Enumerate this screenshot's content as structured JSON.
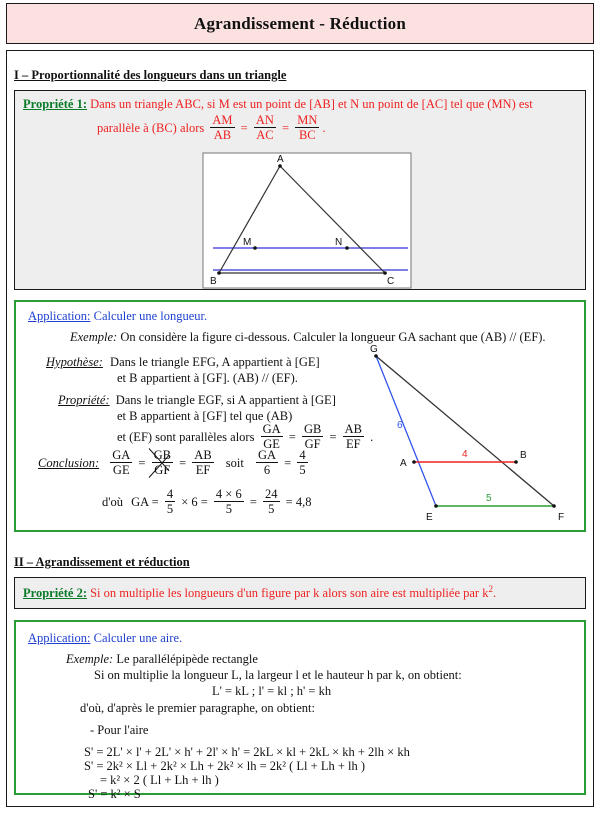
{
  "document": {
    "title": "Agrandissement - Réduction"
  },
  "section1": {
    "heading": "I – Proportionnalité des longueurs dans un triangle",
    "property": {
      "label": "Propriété 1:",
      "line1": "Dans un triangle ABC, si M est un point de [AB] et N un point de [AC] tel que (MN) est",
      "line2": "parallèle à (BC) alors",
      "fractions": [
        {
          "num": "AM",
          "den": "AB"
        },
        {
          "num": "AN",
          "den": "AC"
        },
        {
          "num": "MN",
          "den": "BC"
        }
      ],
      "period": "."
    },
    "figure": {
      "name": "triangle-abc",
      "vertices": {
        "A": "A",
        "B": "B",
        "C": "C",
        "M": "M",
        "N": "N"
      },
      "line_color": "#5555dd",
      "stroke_color": "#333333"
    },
    "application": {
      "label": "Application:",
      "title": "Calculer une longueur.",
      "example_label": "Exemple:",
      "example_text": "On considère la figure ci-dessous. Calculer la longueur GA sachant que (AB) // (EF).",
      "hypothese_label": "Hypothèse:",
      "hypothese_l1": "Dans le triangle EFG, A appartient à [GE]",
      "hypothese_l2": "et B appartient à [GF]. (AB) // (EF).",
      "propriete_label": "Propriété:",
      "propriete_l1": "Dans le triangle EGF, si A appartient à [GE]",
      "propriete_l2": "et B appartient à [GF] tel que (AB)",
      "propriete_l3": "et (EF) sont parallèles alors",
      "propriete_fracs": [
        {
          "num": "GA",
          "den": "GE"
        },
        {
          "num": "GB",
          "den": "GF"
        },
        {
          "num": "AB",
          "den": "EF"
        }
      ],
      "conclusion_label": "Conclusion:",
      "conclusion_fracs": [
        {
          "num": "GA",
          "den": "GE"
        },
        {
          "num": "GB",
          "den": "GF"
        },
        {
          "num": "AB",
          "den": "EF"
        }
      ],
      "soit": "soit",
      "soit_fracs": [
        {
          "num": "GA",
          "den": "6"
        },
        {
          "num": "4",
          "den": "5"
        }
      ],
      "dou": "d'où",
      "final_expr": "GA =",
      "final_fracs": [
        {
          "num": "4",
          "den": "5"
        },
        {
          "num": "4 × 6",
          "den": "5"
        },
        {
          "num": "24",
          "den": "5"
        }
      ],
      "times6": "× 6 =",
      "result": "= 4,8"
    },
    "figure2": {
      "name": "triangle-gef",
      "vertices": {
        "G": "G",
        "A": "A",
        "B": "B",
        "E": "E",
        "F": "F"
      },
      "labels": {
        "ge": "6",
        "ab": "4",
        "ef": "5"
      },
      "colors": {
        "ge": "#3355ee",
        "ab": "#ee2222",
        "ef": "#2a9d34",
        "gf": "#333333"
      }
    }
  },
  "section2": {
    "heading": "II – Agrandissement et réduction",
    "property": {
      "label": "Propriété 2:",
      "text_before": "Si on multiplie les longueurs d'un figure par k alors son aire est multipliée par",
      "k_base": "k",
      "k_exp": "2",
      "period": "."
    },
    "application": {
      "label": "Application:",
      "title": "Calculer une aire.",
      "example_label": "Exemple:",
      "example_text": "Le parallélépipède rectangle",
      "line1": "Si on multiplie la longueur L, la largeur l et le hauteur h par k, on obtient:",
      "line2": "L' = kL ; l' = kl ; h' = kh",
      "line3": "d'où, d'après le premier paragraphe, on obtient:",
      "line4": "- Pour l'aire",
      "eq1": "S' = 2L' × l' + 2L' × h' + 2l' × h' = 2kL × kl + 2kL × kh + 2lh × kh",
      "eq2": "S' = 2k² × Ll + 2k² × Lh + 2k² × lh = 2k² ( Ll + Lh + lh )",
      "eq3": "= k² × 2 ( Ll + Lh + lh )",
      "eq4": "S' = k² × S"
    }
  }
}
